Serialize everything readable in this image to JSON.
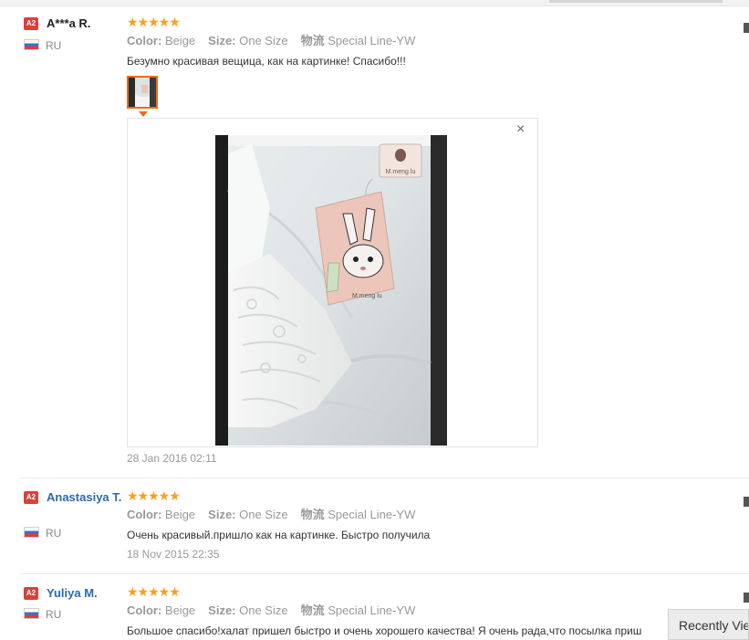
{
  "reviews": [
    {
      "level": "A2",
      "name": "A***a R.",
      "country": "RU",
      "stars": "★★★★★",
      "color_label": "Color:",
      "color_value": "Beige",
      "size_label": "Size:",
      "size_value": "One Size",
      "shipping_label": "物流",
      "shipping_value": "Special Line-YW",
      "text": "Безумно красивая вещица, как на картинке! Спасибо!!!",
      "date": "28 Jan 2016 02:11"
    },
    {
      "level": "A2",
      "name": "Anastasiya T.",
      "country": "RU",
      "stars": "★★★★★",
      "color_label": "Color:",
      "color_value": "Beige",
      "size_label": "Size:",
      "size_value": "One Size",
      "shipping_label": "物流",
      "shipping_value": "Special Line-YW",
      "text": "Очень красивый.пришло как на картинке. Быстро получила",
      "date": "18 Nov 2015 22:35"
    },
    {
      "level": "A2",
      "name": "Yuliya M.",
      "country": "RU",
      "stars": "★★★★★",
      "color_label": "Color:",
      "color_value": "Beige",
      "size_label": "Size:",
      "size_value": "One Size",
      "shipping_label": "物流",
      "shipping_value": "Special Line-YW",
      "text": "Большое спасибо!халат пришел быстро и очень хорошего качества! Я очень рада,что посылка приш"
    }
  ],
  "viewer": {
    "close": "×",
    "tag_brand": "M.meng lu"
  },
  "recently_viewed": "Recently Viewed",
  "colors": {
    "star": "#f7a01a",
    "badge": "#d9413a",
    "link": "#2a6ab1",
    "thumb_border": "#f06a1c"
  }
}
